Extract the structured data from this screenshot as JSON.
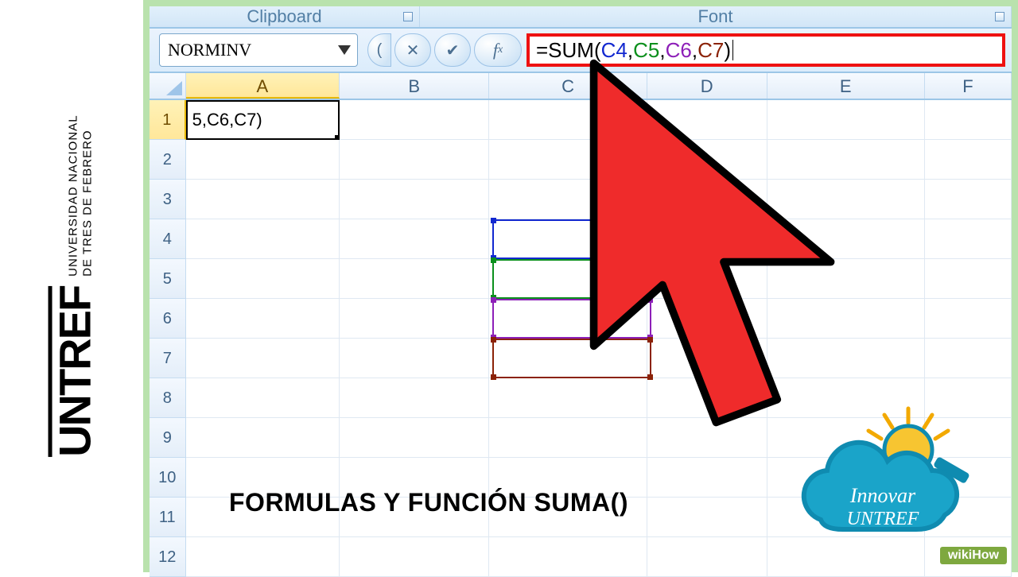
{
  "branding": {
    "university_big": "UNTREF",
    "university_line1": "UNIVERSIDAD NACIONAL",
    "university_line2": "DE TRES DE FEBRERO"
  },
  "ribbon": {
    "group_clipboard": "Clipboard",
    "group_font": "Font"
  },
  "formula_bar": {
    "name_box_value": "NORMINV",
    "formula_prefix": "=SUM(",
    "ref1": "C4",
    "ref2": "C5",
    "ref3": "C6",
    "ref4": "C7",
    "formula_suffix": ")",
    "comma": ","
  },
  "columns": [
    "A",
    "B",
    "C",
    "D",
    "E",
    "F"
  ],
  "rows": [
    "1",
    "2",
    "3",
    "4",
    "5",
    "6",
    "7",
    "8",
    "9",
    "10",
    "11",
    "12"
  ],
  "cells": {
    "A1": "5,C6,C7)"
  },
  "reference_colors": {
    "C4": "#1228d0",
    "C5": "#0b8f1c",
    "C6": "#8d1fb8",
    "C7": "#8b2207"
  },
  "overlay": {
    "title": "FORMULAS Y FUNCIÓN SUMA()"
  },
  "badge": {
    "line1": "Innovar",
    "line2": "UNTREF"
  },
  "watermark": "wikiHow"
}
